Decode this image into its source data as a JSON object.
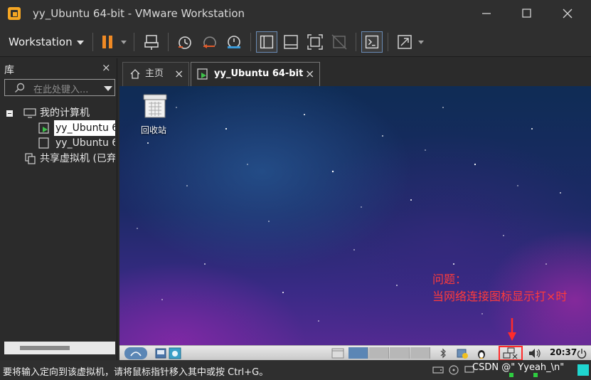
{
  "window": {
    "title": "yy_Ubuntu 64-bit - VMware Workstation"
  },
  "toolbar": {
    "workstation_menu": "Workstation"
  },
  "library": {
    "title": "库",
    "close": "×",
    "search_placeholder": "在此处键入...",
    "tree": {
      "my_computer": "我的计算机",
      "vm1": "yy_Ubuntu 6",
      "vm2": "yy_Ubuntu 6",
      "shared": "共享虚拟机 (已弃"
    }
  },
  "tabs": [
    {
      "label": "主页",
      "close": "×"
    },
    {
      "label": "yy_Ubuntu 64-bit",
      "close": "×"
    }
  ],
  "vm_screen": {
    "trash_label": "回收站",
    "annotation_line1": "问题：",
    "annotation_line2": "当网络连接图标显示打×时",
    "clock": "20:37"
  },
  "statusbar": {
    "message": "要将输入定向到该虚拟机，请将鼠标指针移入其中或按 Ctrl+G。",
    "watermark": "CSDN @\" Yyeah_\\n\""
  },
  "colors": {
    "annotation": "#ff3b3b",
    "pause_orange": "#f08a24",
    "highlight_border": "#ff2b2b"
  }
}
